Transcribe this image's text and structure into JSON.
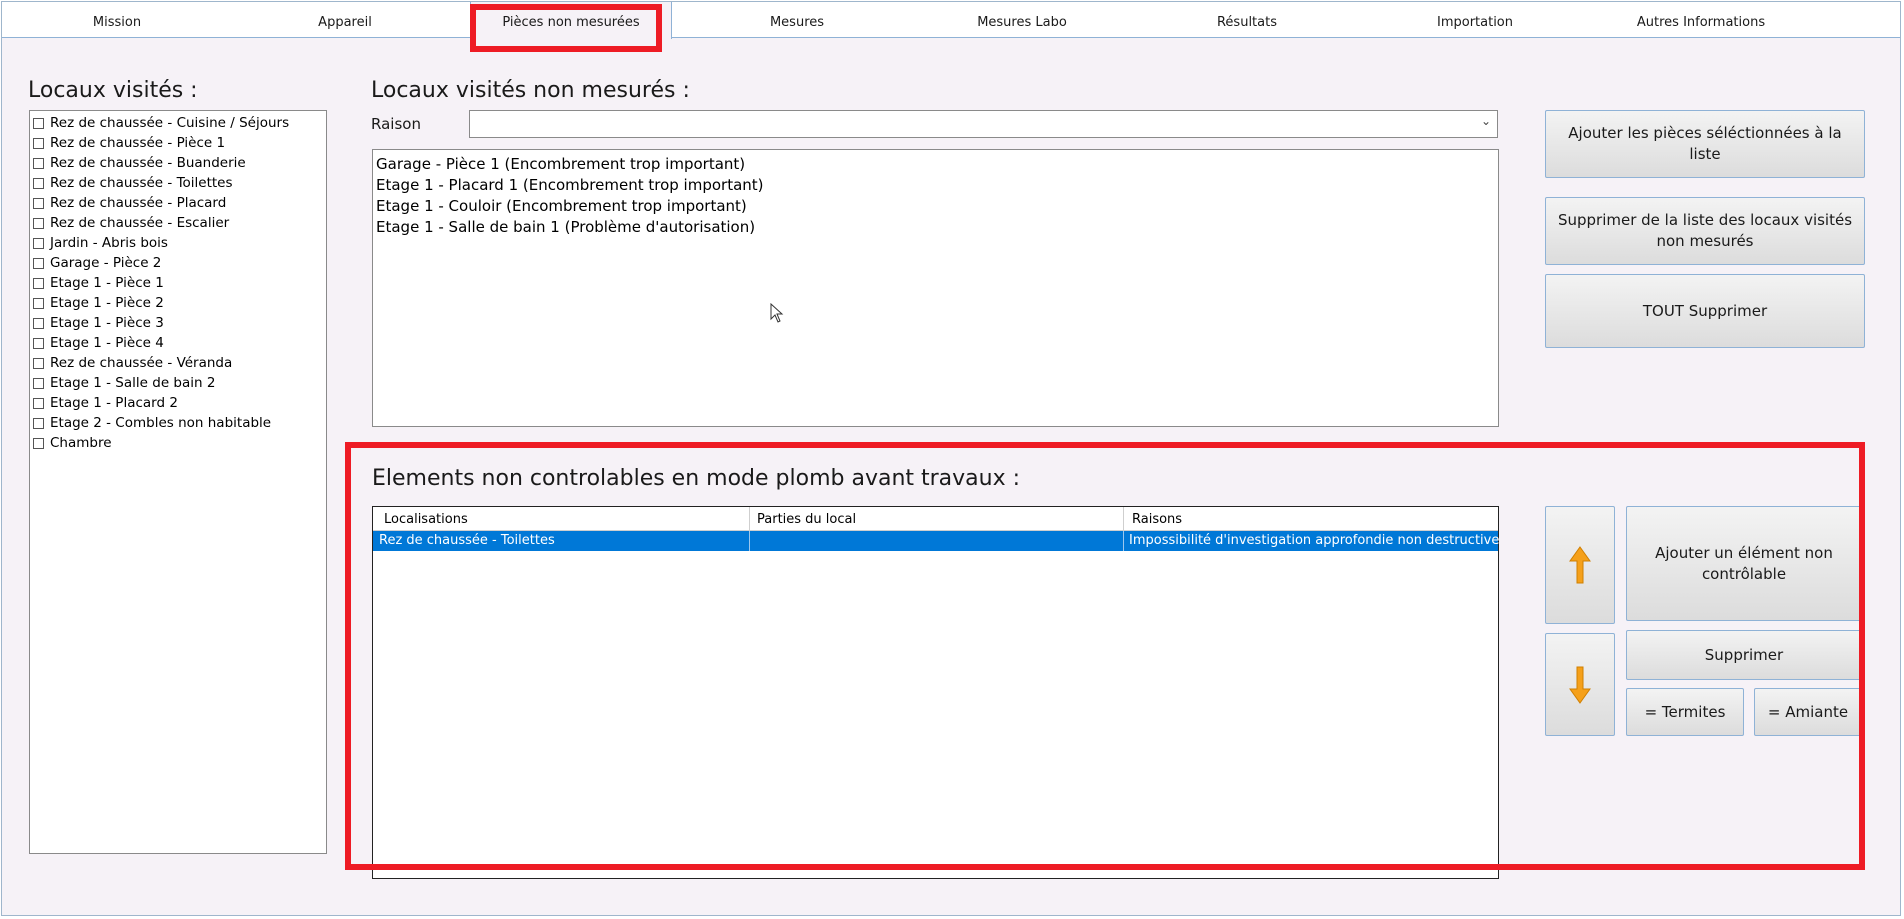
{
  "tabs": [
    {
      "label": "Mission"
    },
    {
      "label": "Appareil"
    },
    {
      "label": "Pièces non mesurées"
    },
    {
      "label": "Mesures"
    },
    {
      "label": "Mesures Labo"
    },
    {
      "label": "Résultats"
    },
    {
      "label": "Importation"
    },
    {
      "label": "Autres Informations"
    }
  ],
  "visited": {
    "title": "Locaux visités :",
    "items": [
      "Rez de chaussée - Cuisine / Séjours",
      "Rez de chaussée - Pièce 1",
      "Rez de chaussée - Buanderie",
      "Rez de chaussée - Toilettes",
      "Rez de chaussée - Placard",
      "Rez de chaussée - Escalier",
      "Jardin - Abris bois",
      "Garage - Pièce 2",
      "Etage 1 - Pièce 1",
      "Etage 1 - Pièce 2",
      "Etage 1 - Pièce 3",
      "Etage 1 - Pièce 4",
      "Rez de chaussée - Véranda",
      "Etage 1 - Salle de bain 2",
      "Etage 1 - Placard 2",
      "Etage 2 - Combles non habitable",
      "Chambre"
    ]
  },
  "not_measured": {
    "title": "Locaux visités non mesurés :",
    "reason_label": "Raison",
    "reason_value": "",
    "items": [
      "Garage - Pièce 1 (Encombrement trop important)",
      "Etage 1 - Placard 1 (Encombrement trop important)",
      "Etage 1 - Couloir (Encombrement trop important)",
      "Etage 1 - Salle de bain 1 (Problème d'autorisation)"
    ],
    "buttons": {
      "add": "Ajouter les pièces séléctionnées à la liste",
      "remove": "Supprimer de la liste des locaux visités non mesurés",
      "remove_all": "TOUT Supprimer"
    }
  },
  "non_controllable": {
    "title": "Elements non controlables en mode plomb avant travaux :",
    "columns": [
      "Localisations",
      "Parties du local",
      "Raisons"
    ],
    "rows": [
      {
        "loc": "Rez de chaussée - Toilettes",
        "part": "",
        "reason": "Impossibilité d'investigation approfondie non destructive"
      }
    ],
    "buttons": {
      "add": "Ajouter un élément non contrôlable",
      "delete": "Supprimer",
      "termites": "= Termites",
      "amiante": "= Amiante"
    }
  },
  "colors": {
    "highlight": "#ee1c25",
    "selection": "#0078d7",
    "arrow": "#f5a01a"
  }
}
